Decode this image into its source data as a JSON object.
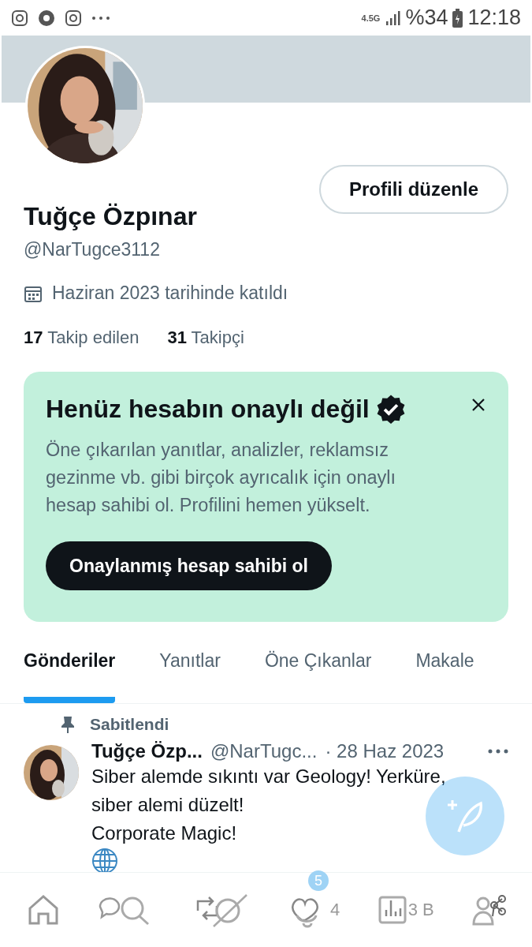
{
  "status_bar": {
    "network": "4.5G",
    "battery": "%34",
    "time": "12:18"
  },
  "profile": {
    "edit_button": "Profili düzenle",
    "name": "Tuğçe Özpınar",
    "handle": "@NarTugce3112",
    "joined": "Haziran 2023 tarihinde katıldı",
    "following_count": "17",
    "following_label": "Takip edilen",
    "followers_count": "31",
    "followers_label": "Takipçi"
  },
  "verify_card": {
    "title": "Henüz hesabın onaylı değil",
    "body": "Öne çıkarılan yanıtlar, analizler, reklamsız gezinme vb. gibi birçok ayrıcalık için onaylı hesap sahibi ol. Profilini hemen yükselt.",
    "button": "Onaylanmış hesap sahibi ol"
  },
  "tabs": [
    {
      "label": "Gönderiler",
      "selected": true
    },
    {
      "label": "Yanıtlar",
      "selected": false
    },
    {
      "label": "Öne Çıkanlar",
      "selected": false
    },
    {
      "label": "Makale",
      "selected": false
    }
  ],
  "pinned_post": {
    "pin_label": "Sabitlendi",
    "author": "Tuğçe Özp...",
    "handle": "@NarTugc...",
    "date": "· 28 Haz 2023",
    "lines": [
      "Siber alemde sıkıntı var Geology! Yerküre,",
      "siber alemi düzelt!",
      "Corporate Magic!"
    ],
    "likes": "4",
    "views": "3 B"
  },
  "bottom_nav": {
    "notification_badge": "5"
  }
}
